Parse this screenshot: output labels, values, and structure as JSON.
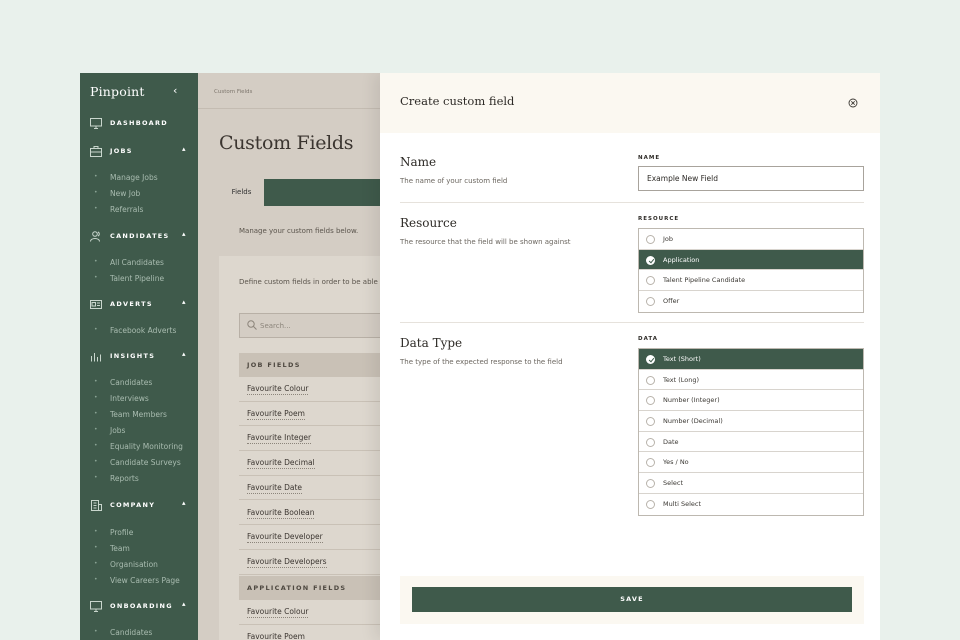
{
  "sidebar": {
    "brand": "Pinpoint",
    "sections": [
      {
        "label": "DASHBOARD",
        "icon": "monitor-icon",
        "items": []
      },
      {
        "label": "JOBS",
        "icon": "briefcase-icon",
        "items": [
          "Manage Jobs",
          "New Job",
          "Referrals"
        ]
      },
      {
        "label": "CANDIDATES",
        "icon": "users-icon",
        "items": [
          "All Candidates",
          "Talent Pipeline"
        ]
      },
      {
        "label": "ADVERTS",
        "icon": "advert-icon",
        "items": [
          "Facebook Adverts"
        ]
      },
      {
        "label": "INSIGHTS",
        "icon": "bar-chart-icon",
        "items": [
          "Candidates",
          "Interviews",
          "Team Members",
          "Jobs",
          "Equality Monitoring",
          "Candidate Surveys",
          "Reports"
        ]
      },
      {
        "label": "COMPANY",
        "icon": "building-icon",
        "items": [
          "Profile",
          "Team",
          "Organisation",
          "View Careers Page"
        ]
      },
      {
        "label": "ONBOARDING",
        "icon": "monitor-icon",
        "items": [
          "Candidates"
        ]
      }
    ]
  },
  "page": {
    "breadcrumb": "Custom Fields",
    "title": "Custom Fields",
    "tab": "Fields",
    "manage_text": "Manage your custom fields below.",
    "define_text": "Define custom fields in order to be able",
    "search_placeholder": "Search...",
    "job_fields_header": "JOB FIELDS",
    "job_fields": [
      "Favourite Colour",
      "Favourite Poem",
      "Favourite Integer",
      "Favourite Decimal",
      "Favourite Date",
      "Favourite Boolean",
      "Favourite Developer",
      "Favourite Developers"
    ],
    "application_fields_header": "APPLICATION FIELDS",
    "application_fields": [
      "Favourite Colour",
      "Favourite Poem"
    ]
  },
  "modal": {
    "title": "Create custom field",
    "name": {
      "title": "Name",
      "description": "The name of your custom field",
      "label": "NAME",
      "value": "Example New Field"
    },
    "resource": {
      "title": "Resource",
      "description": "The resource that the field will be shown against",
      "label": "RESOURCE",
      "options": [
        "Job",
        "Application",
        "Talent Pipeline Candidate",
        "Offer"
      ],
      "selected": "Application"
    },
    "data_type": {
      "title": "Data Type",
      "description": "The type of the expected response to the field",
      "label": "DATA",
      "options": [
        "Text (Short)",
        "Text (Long)",
        "Number (Integer)",
        "Number (Decimal)",
        "Date",
        "Yes / No",
        "Select",
        "Multi Select"
      ],
      "selected": "Text (Short)"
    },
    "save_label": "SAVE"
  },
  "colors": {
    "sidebar": "#3f5a4b",
    "accent": "#3f5a4b",
    "page_bg": "#e9f1ec"
  }
}
